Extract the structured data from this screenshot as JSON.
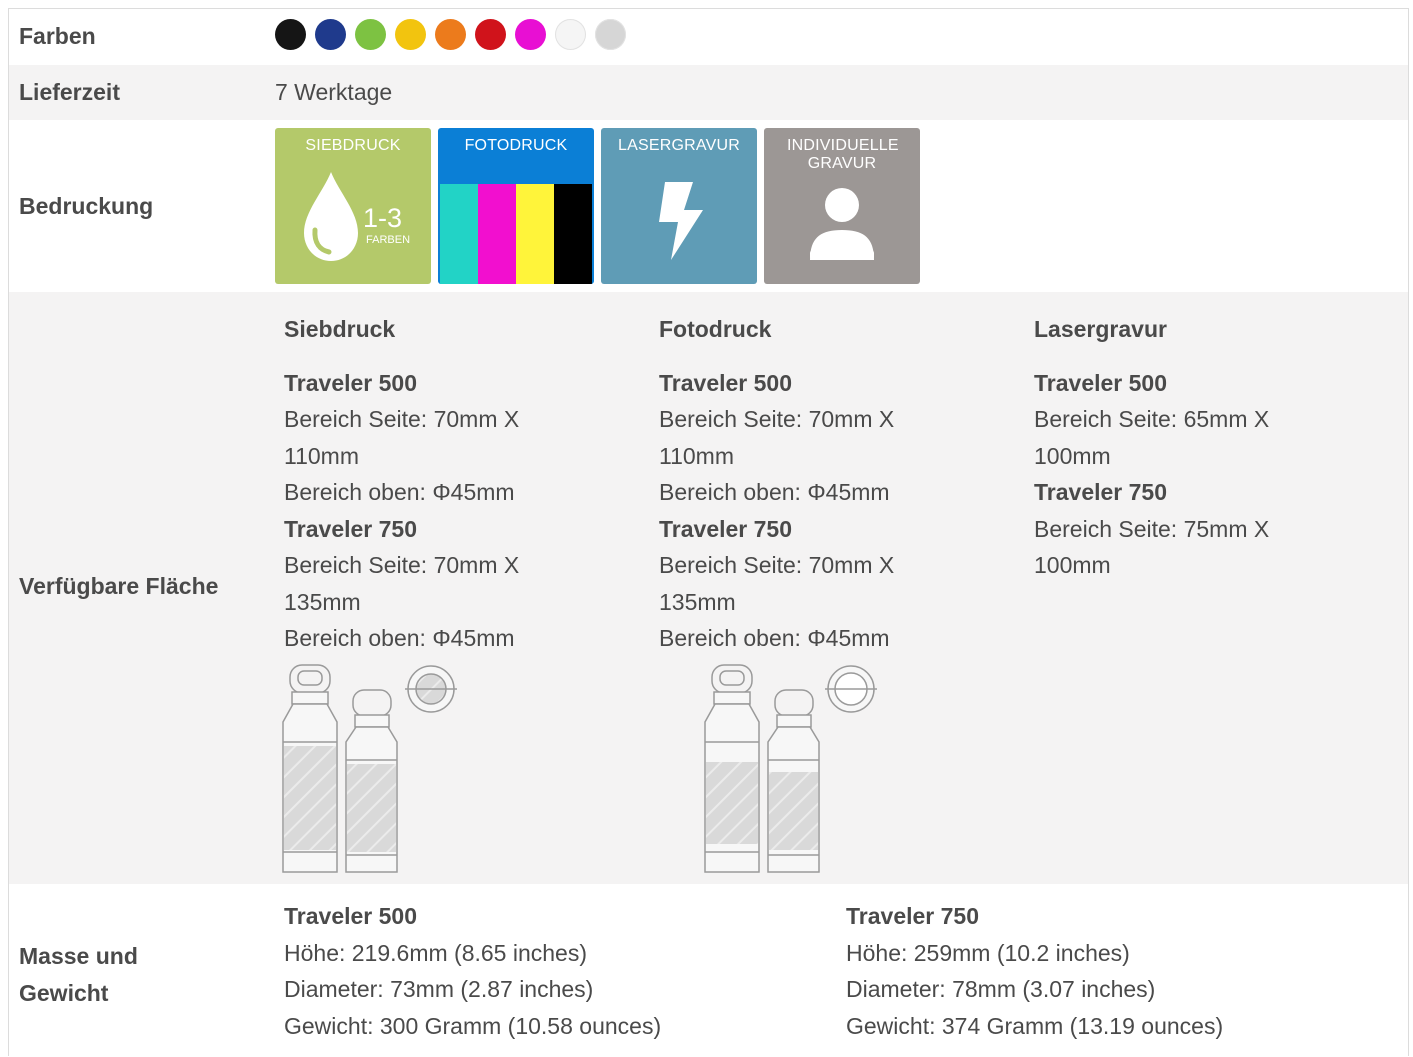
{
  "rows": {
    "farben": {
      "label": "Farben",
      "colors": [
        "#151515",
        "#1f3a8c",
        "#7dc242",
        "#f2c40f",
        "#ec7b1c",
        "#d0131b",
        "#e80fd3",
        "#f5f5f5",
        "#d6d6d6"
      ]
    },
    "lieferzeit": {
      "label": "Lieferzeit",
      "value": "7 Werktage"
    },
    "bedruckung": {
      "label": "Bedruckung",
      "tiles": [
        {
          "title": "SIEBDRUCK",
          "badge": "1-3",
          "badge_sub": "FARBEN",
          "color": "#b4c96a"
        },
        {
          "title": "FOTODRUCK",
          "color": "#0b7fd6",
          "cmyk": [
            "#22d3c6",
            "#f20fcf",
            "#fff43a",
            "#000000"
          ]
        },
        {
          "title": "LASERGRAVUR",
          "color": "#5f9cb6"
        },
        {
          "title": "INDIVIDUELLE GRAVUR",
          "color": "#9c9795"
        }
      ]
    },
    "flaeche": {
      "label": "Verfügbare Fläche",
      "columns": [
        {
          "heading": "Siebdruck",
          "lines": [
            {
              "b": true,
              "t": "Traveler 500"
            },
            {
              "t": "Bereich Seite: 70mm X"
            },
            {
              "t": "110mm"
            },
            {
              "t": "Bereich oben: Φ45mm"
            },
            {
              "b": true,
              "t": "Traveler 750"
            },
            {
              "t": "Bereich Seite: 70mm X"
            },
            {
              "t": "135mm"
            },
            {
              "t": "Bereich oben: Φ45mm"
            }
          ]
        },
        {
          "heading": "Fotodruck",
          "lines": [
            {
              "b": true,
              "t": "Traveler 500"
            },
            {
              "t": "Bereich Seite: 70mm X"
            },
            {
              "t": "110mm"
            },
            {
              "t": "Bereich oben: Φ45mm"
            },
            {
              "b": true,
              "t": "Traveler 750"
            },
            {
              "t": "Bereich Seite: 70mm X"
            },
            {
              "t": "135mm"
            },
            {
              "t": "Bereich oben: Φ45mm"
            }
          ]
        },
        {
          "heading": "Lasergravur",
          "lines": [
            {
              "b": true,
              "t": "Traveler 500"
            },
            {
              "t": "Bereich Seite: 65mm X"
            },
            {
              "t": "100mm"
            },
            {
              "b": true,
              "t": "Traveler 750"
            },
            {
              "t": "Bereich Seite: 75mm X"
            },
            {
              "t": "100mm"
            }
          ]
        }
      ]
    },
    "masse": {
      "label_line1": "Masse und",
      "label_line2": "Gewicht",
      "columns": [
        {
          "title": "Traveler 500",
          "hoehe": "Höhe: 219.6mm (8.65 inches)",
          "diameter": "Diameter: 73mm (2.87 inches)",
          "gewicht": "Gewicht: 300 Gramm (10.58 ounces)"
        },
        {
          "title": "Traveler 750",
          "hoehe": "Höhe: 259mm (10.2 inches)",
          "diameter": "Diameter: 78mm (3.07 inches)",
          "gewicht": "Gewicht: 374 Gramm (13.19 ounces)"
        }
      ]
    }
  }
}
